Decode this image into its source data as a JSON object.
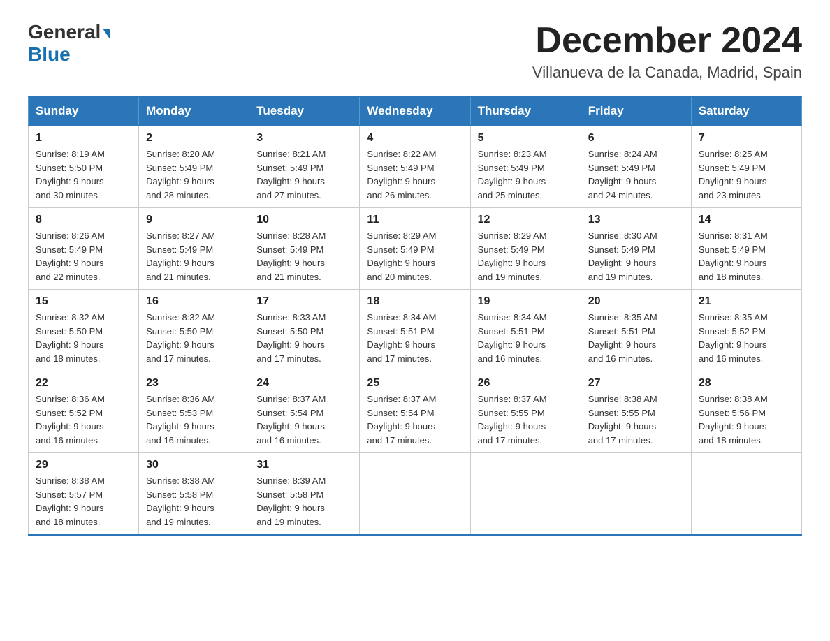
{
  "header": {
    "logo_general": "General",
    "logo_blue": "Blue",
    "month_year": "December 2024",
    "location": "Villanueva de la Canada, Madrid, Spain"
  },
  "days_of_week": [
    "Sunday",
    "Monday",
    "Tuesday",
    "Wednesday",
    "Thursday",
    "Friday",
    "Saturday"
  ],
  "weeks": [
    [
      {
        "day": 1,
        "sunrise": "8:19 AM",
        "sunset": "5:50 PM",
        "daylight": "9 hours and 30 minutes."
      },
      {
        "day": 2,
        "sunrise": "8:20 AM",
        "sunset": "5:49 PM",
        "daylight": "9 hours and 28 minutes."
      },
      {
        "day": 3,
        "sunrise": "8:21 AM",
        "sunset": "5:49 PM",
        "daylight": "9 hours and 27 minutes."
      },
      {
        "day": 4,
        "sunrise": "8:22 AM",
        "sunset": "5:49 PM",
        "daylight": "9 hours and 26 minutes."
      },
      {
        "day": 5,
        "sunrise": "8:23 AM",
        "sunset": "5:49 PM",
        "daylight": "9 hours and 25 minutes."
      },
      {
        "day": 6,
        "sunrise": "8:24 AM",
        "sunset": "5:49 PM",
        "daylight": "9 hours and 24 minutes."
      },
      {
        "day": 7,
        "sunrise": "8:25 AM",
        "sunset": "5:49 PM",
        "daylight": "9 hours and 23 minutes."
      }
    ],
    [
      {
        "day": 8,
        "sunrise": "8:26 AM",
        "sunset": "5:49 PM",
        "daylight": "9 hours and 22 minutes."
      },
      {
        "day": 9,
        "sunrise": "8:27 AM",
        "sunset": "5:49 PM",
        "daylight": "9 hours and 21 minutes."
      },
      {
        "day": 10,
        "sunrise": "8:28 AM",
        "sunset": "5:49 PM",
        "daylight": "9 hours and 21 minutes."
      },
      {
        "day": 11,
        "sunrise": "8:29 AM",
        "sunset": "5:49 PM",
        "daylight": "9 hours and 20 minutes."
      },
      {
        "day": 12,
        "sunrise": "8:29 AM",
        "sunset": "5:49 PM",
        "daylight": "9 hours and 19 minutes."
      },
      {
        "day": 13,
        "sunrise": "8:30 AM",
        "sunset": "5:49 PM",
        "daylight": "9 hours and 19 minutes."
      },
      {
        "day": 14,
        "sunrise": "8:31 AM",
        "sunset": "5:49 PM",
        "daylight": "9 hours and 18 minutes."
      }
    ],
    [
      {
        "day": 15,
        "sunrise": "8:32 AM",
        "sunset": "5:50 PM",
        "daylight": "9 hours and 18 minutes."
      },
      {
        "day": 16,
        "sunrise": "8:32 AM",
        "sunset": "5:50 PM",
        "daylight": "9 hours and 17 minutes."
      },
      {
        "day": 17,
        "sunrise": "8:33 AM",
        "sunset": "5:50 PM",
        "daylight": "9 hours and 17 minutes."
      },
      {
        "day": 18,
        "sunrise": "8:34 AM",
        "sunset": "5:51 PM",
        "daylight": "9 hours and 17 minutes."
      },
      {
        "day": 19,
        "sunrise": "8:34 AM",
        "sunset": "5:51 PM",
        "daylight": "9 hours and 16 minutes."
      },
      {
        "day": 20,
        "sunrise": "8:35 AM",
        "sunset": "5:51 PM",
        "daylight": "9 hours and 16 minutes."
      },
      {
        "day": 21,
        "sunrise": "8:35 AM",
        "sunset": "5:52 PM",
        "daylight": "9 hours and 16 minutes."
      }
    ],
    [
      {
        "day": 22,
        "sunrise": "8:36 AM",
        "sunset": "5:52 PM",
        "daylight": "9 hours and 16 minutes."
      },
      {
        "day": 23,
        "sunrise": "8:36 AM",
        "sunset": "5:53 PM",
        "daylight": "9 hours and 16 minutes."
      },
      {
        "day": 24,
        "sunrise": "8:37 AM",
        "sunset": "5:54 PM",
        "daylight": "9 hours and 16 minutes."
      },
      {
        "day": 25,
        "sunrise": "8:37 AM",
        "sunset": "5:54 PM",
        "daylight": "9 hours and 17 minutes."
      },
      {
        "day": 26,
        "sunrise": "8:37 AM",
        "sunset": "5:55 PM",
        "daylight": "9 hours and 17 minutes."
      },
      {
        "day": 27,
        "sunrise": "8:38 AM",
        "sunset": "5:55 PM",
        "daylight": "9 hours and 17 minutes."
      },
      {
        "day": 28,
        "sunrise": "8:38 AM",
        "sunset": "5:56 PM",
        "daylight": "9 hours and 18 minutes."
      }
    ],
    [
      {
        "day": 29,
        "sunrise": "8:38 AM",
        "sunset": "5:57 PM",
        "daylight": "9 hours and 18 minutes."
      },
      {
        "day": 30,
        "sunrise": "8:38 AM",
        "sunset": "5:58 PM",
        "daylight": "9 hours and 19 minutes."
      },
      {
        "day": 31,
        "sunrise": "8:39 AM",
        "sunset": "5:58 PM",
        "daylight": "9 hours and 19 minutes."
      },
      null,
      null,
      null,
      null
    ]
  ],
  "labels": {
    "sunrise": "Sunrise:",
    "sunset": "Sunset:",
    "daylight": "Daylight:"
  }
}
